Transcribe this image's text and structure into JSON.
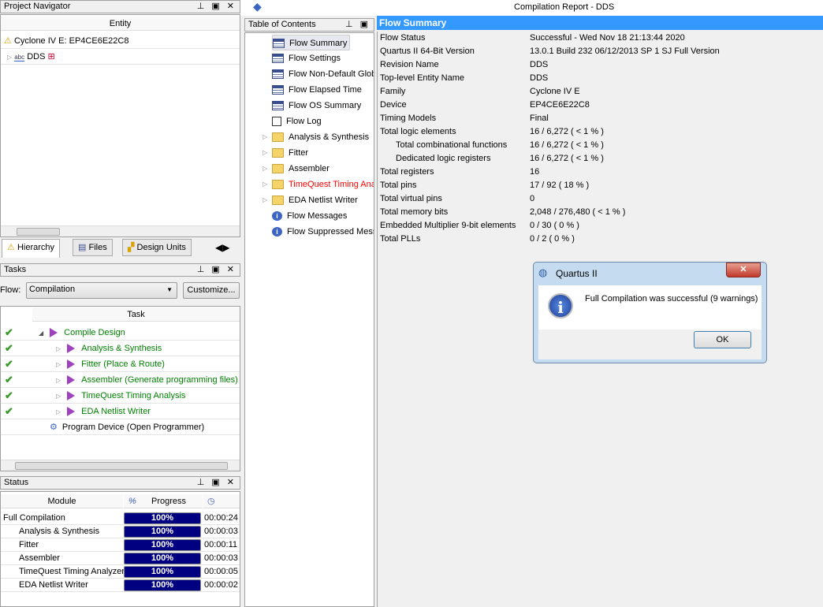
{
  "window_title": "Compilation Report - DDS",
  "project_navigator": {
    "title": "Project Navigator",
    "column": "Entity",
    "device": "Cyclone IV E: EP4CE6E22C8",
    "entity": "DDS",
    "tabs": [
      "Hierarchy",
      "Files",
      "Design Units"
    ]
  },
  "tasks": {
    "title": "Tasks",
    "flow_label": "Flow:",
    "flow_value": "Compilation",
    "customize": "Customize...",
    "column": "Task",
    "items": [
      {
        "label": "Compile Design",
        "done": true
      },
      {
        "label": "Analysis & Synthesis",
        "done": true
      },
      {
        "label": "Fitter (Place & Route)",
        "done": true
      },
      {
        "label": "Assembler (Generate programming files)",
        "done": true
      },
      {
        "label": "TimeQuest Timing Analysis",
        "done": true
      },
      {
        "label": "EDA Netlist Writer",
        "done": true
      },
      {
        "label": "Program Device (Open Programmer)",
        "done": false
      }
    ]
  },
  "status": {
    "title": "Status",
    "columns": [
      "Module",
      "%",
      "Progress"
    ],
    "rows": [
      {
        "module": "Full Compilation",
        "progress": "100%",
        "time": "00:00:24"
      },
      {
        "module": "Analysis & Synthesis",
        "progress": "100%",
        "time": "00:00:03"
      },
      {
        "module": "Fitter",
        "progress": "100%",
        "time": "00:00:11"
      },
      {
        "module": "Assembler",
        "progress": "100%",
        "time": "00:00:03"
      },
      {
        "module": "TimeQuest Timing Analyzer",
        "progress": "100%",
        "time": "00:00:05"
      },
      {
        "module": "EDA Netlist Writer",
        "progress": "100%",
        "time": "00:00:02"
      }
    ]
  },
  "toc": {
    "title": "Table of Contents",
    "items": [
      {
        "label": "Flow Summary",
        "icon": "table"
      },
      {
        "label": "Flow Settings",
        "icon": "table"
      },
      {
        "label": "Flow Non-Default Global",
        "icon": "table"
      },
      {
        "label": "Flow Elapsed Time",
        "icon": "table"
      },
      {
        "label": "Flow OS Summary",
        "icon": "table"
      },
      {
        "label": "Flow Log",
        "icon": "doc"
      },
      {
        "label": "Analysis & Synthesis",
        "icon": "folder"
      },
      {
        "label": "Fitter",
        "icon": "folder"
      },
      {
        "label": "Assembler",
        "icon": "folder"
      },
      {
        "label": "TimeQuest Timing Analyz",
        "icon": "folder"
      },
      {
        "label": "EDA Netlist Writer",
        "icon": "folder"
      },
      {
        "label": "Flow Messages",
        "icon": "info"
      },
      {
        "label": "Flow Suppressed Messag",
        "icon": "info"
      }
    ]
  },
  "report": {
    "title": "Flow Summary",
    "rows": [
      [
        "Flow Status",
        "Successful - Wed Nov 18 21:13:44 2020"
      ],
      [
        "Quartus II 64-Bit Version",
        "13.0.1 Build 232 06/12/2013 SP 1 SJ Full Version"
      ],
      [
        "Revision Name",
        "DDS"
      ],
      [
        "Top-level Entity Name",
        "DDS"
      ],
      [
        "Family",
        "Cyclone IV E"
      ],
      [
        "Device",
        "EP4CE6E22C8"
      ],
      [
        "Timing Models",
        "Final"
      ],
      [
        "Total logic elements",
        "16 / 6,272 ( < 1 % )"
      ],
      [
        "Total combinational functions",
        "16 / 6,272 ( < 1 % )"
      ],
      [
        "Dedicated logic registers",
        "16 / 6,272 ( < 1 % )"
      ],
      [
        "Total registers",
        "16"
      ],
      [
        "Total pins",
        "17 / 92 ( 18 % )"
      ],
      [
        "Total virtual pins",
        "0"
      ],
      [
        "Total memory bits",
        "2,048 / 276,480 ( < 1 % )"
      ],
      [
        "Embedded Multiplier 9-bit elements",
        "0 / 30 ( 0 % )"
      ],
      [
        "Total PLLs",
        "0 / 2 ( 0 % )"
      ]
    ]
  },
  "dialog": {
    "title": "Quartus II",
    "message": "Full Compilation was successful (9 warnings)",
    "ok": "OK"
  },
  "colors": {
    "header_blue": "#3399ff",
    "progress": "#000080",
    "task_green": "#008000",
    "warning_red": "#ff0000"
  }
}
